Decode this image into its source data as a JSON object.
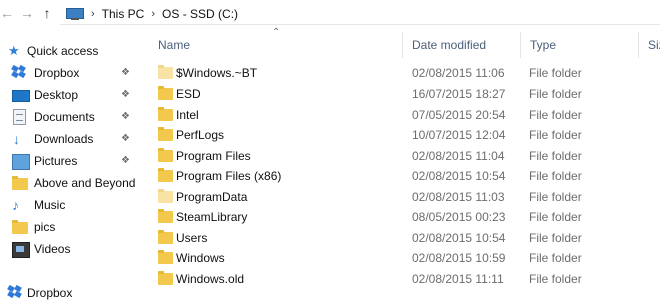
{
  "address_bar": {
    "back_icon": "back-arrow-icon",
    "forward_icon": "forward-arrow-icon",
    "up_icon": "up-arrow-icon",
    "pc_icon": "this-pc-icon",
    "breadcrumb": [
      "This PC",
      "OS - SSD (C:)"
    ]
  },
  "nav_pane": {
    "items": [
      {
        "label": "Quick access",
        "icon": "star-icon",
        "pinned": false
      },
      {
        "label": "Dropbox",
        "icon": "dropbox-icon",
        "pinned": true
      },
      {
        "label": "Desktop",
        "icon": "desktop-icon",
        "pinned": true
      },
      {
        "label": "Documents",
        "icon": "documents-icon",
        "pinned": true
      },
      {
        "label": "Downloads",
        "icon": "downloads-icon",
        "pinned": true
      },
      {
        "label": "Pictures",
        "icon": "pictures-icon",
        "pinned": true
      },
      {
        "label": "Above and Beyond",
        "icon": "folder-icon",
        "pinned": false
      },
      {
        "label": "Music",
        "icon": "music-icon",
        "pinned": false
      },
      {
        "label": "pics",
        "icon": "folder-icon",
        "pinned": false
      },
      {
        "label": "Videos",
        "icon": "videos-icon",
        "pinned": false
      },
      {
        "label": "Dropbox",
        "icon": "dropbox-icon",
        "pinned": false
      }
    ]
  },
  "columns": {
    "name": "Name",
    "date_modified": "Date modified",
    "type": "Type",
    "size": "Size"
  },
  "files": [
    {
      "name": "$Windows.~BT",
      "date": "02/08/2015 11:06",
      "type": "File folder",
      "faded": true
    },
    {
      "name": "ESD",
      "date": "16/07/2015 18:27",
      "type": "File folder",
      "faded": false
    },
    {
      "name": "Intel",
      "date": "07/05/2015 20:54",
      "type": "File folder",
      "faded": false
    },
    {
      "name": "PerfLogs",
      "date": "10/07/2015 12:04",
      "type": "File folder",
      "faded": false
    },
    {
      "name": "Program Files",
      "date": "02/08/2015 11:04",
      "type": "File folder",
      "faded": false
    },
    {
      "name": "Program Files (x86)",
      "date": "02/08/2015 10:54",
      "type": "File folder",
      "faded": false
    },
    {
      "name": "ProgramData",
      "date": "02/08/2015 11:03",
      "type": "File folder",
      "faded": true
    },
    {
      "name": "SteamLibrary",
      "date": "08/05/2015 00:23",
      "type": "File folder",
      "faded": false
    },
    {
      "name": "Users",
      "date": "02/08/2015 10:54",
      "type": "File folder",
      "faded": false
    },
    {
      "name": "Windows",
      "date": "02/08/2015 10:59",
      "type": "File folder",
      "faded": false
    },
    {
      "name": "Windows.old",
      "date": "02/08/2015 11:11",
      "type": "File folder",
      "faded": false
    }
  ],
  "colors": {
    "accent": "#2f7fd4",
    "folder": "#f2c94c",
    "header_text": "#4c607a"
  }
}
